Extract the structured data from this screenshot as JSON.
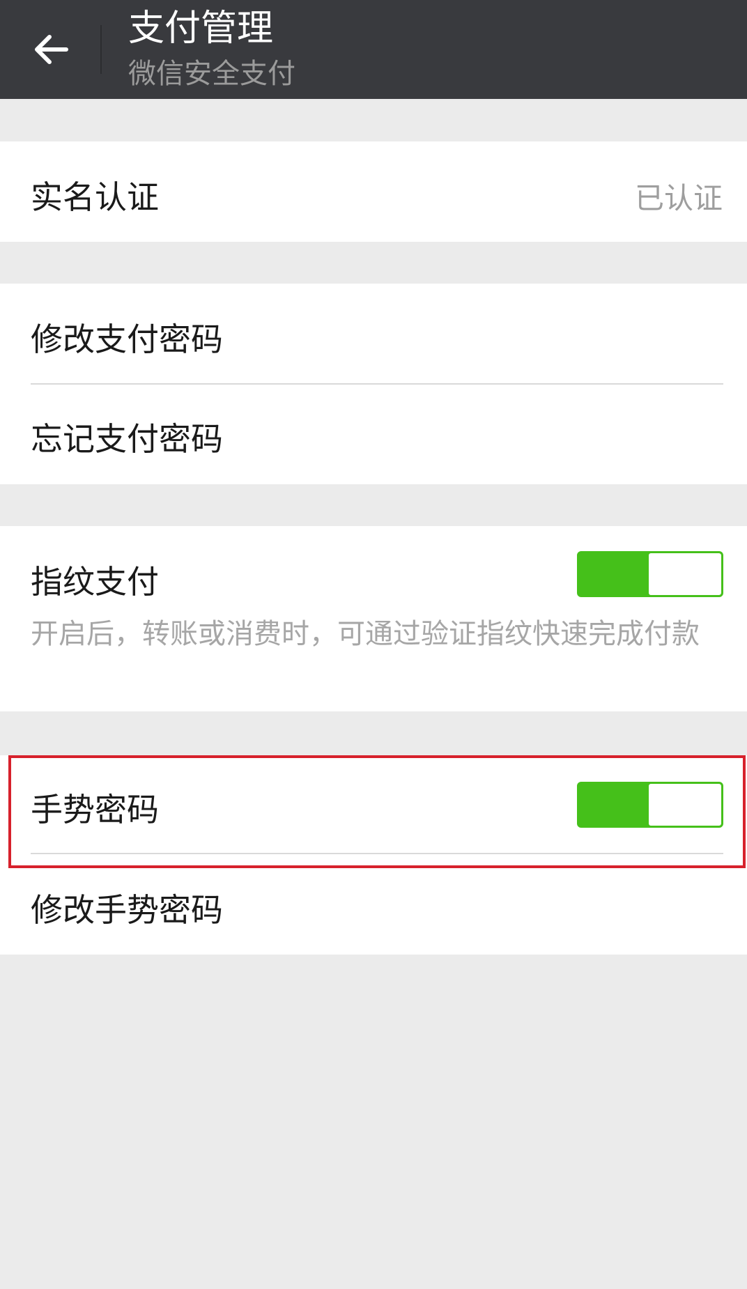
{
  "header": {
    "title": "支付管理",
    "subtitle": "微信安全支付",
    "back_icon": "arrow-left-icon"
  },
  "groups": {
    "identity": {
      "label": "实名认证",
      "value": "已认证"
    },
    "password": {
      "change": "修改支付密码",
      "forgot": "忘记支付密码"
    },
    "fingerprint": {
      "label": "指纹支付",
      "enabled": true,
      "description": "开启后，转账或消费时，可通过验证指纹快速完成付款"
    },
    "gesture": {
      "label": "手势密码",
      "enabled": true,
      "change": "修改手势密码"
    }
  },
  "colors": {
    "topbar": "#393a3e",
    "toggle_on": "#45c01a",
    "highlight": "#d7212c",
    "background": "#ebebeb"
  }
}
